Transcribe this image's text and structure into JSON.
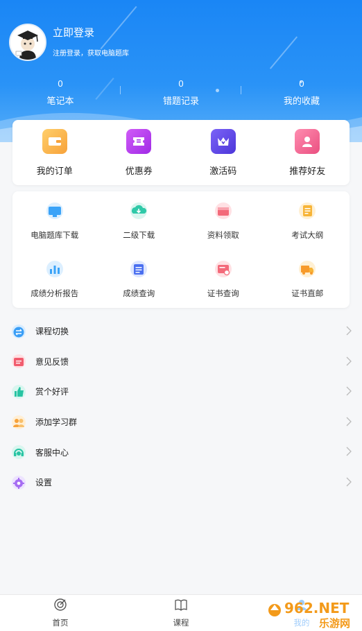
{
  "header": {
    "login_title": "立即登录",
    "login_subtitle": "注册登录，获取电脑题库",
    "stats": [
      {
        "value": "0",
        "label": "笔记本"
      },
      {
        "value": "0",
        "label": "错题记录"
      },
      {
        "value": "0",
        "label": "我的收藏"
      }
    ]
  },
  "quick_actions": [
    {
      "label": "我的订单",
      "icon": "wallet-icon",
      "color": "#f9b24a"
    },
    {
      "label": "优惠券",
      "icon": "coupon-icon",
      "color": "#b33ff0"
    },
    {
      "label": "激活码",
      "icon": "crown-icon",
      "color": "#6a4cf0"
    },
    {
      "label": "推荐好友",
      "icon": "user-icon",
      "color": "#f36f9a"
    }
  ],
  "services": [
    {
      "label": "电脑题库下载",
      "icon": "monitor-icon"
    },
    {
      "label": "二级下载",
      "icon": "cloud-download-icon"
    },
    {
      "label": "资料领取",
      "icon": "gift-icon"
    },
    {
      "label": "考试大纲",
      "icon": "document-icon"
    },
    {
      "label": "成绩分析报告",
      "icon": "bar-chart-icon"
    },
    {
      "label": "成绩查询",
      "icon": "search-list-icon"
    },
    {
      "label": "证书查询",
      "icon": "certificate-icon"
    },
    {
      "label": "证书直邮",
      "icon": "truck-icon"
    }
  ],
  "menu": [
    {
      "label": "课程切换",
      "icon": "switch-icon"
    },
    {
      "label": "意见反馈",
      "icon": "feedback-icon"
    },
    {
      "label": "赏个好评",
      "icon": "thumbs-up-icon"
    },
    {
      "label": "添加学习群",
      "icon": "group-icon"
    },
    {
      "label": "客服中心",
      "icon": "headset-icon"
    },
    {
      "label": "设置",
      "icon": "gear-icon"
    }
  ],
  "tabbar": [
    {
      "label": "首页",
      "icon": "target-icon"
    },
    {
      "label": "课程",
      "icon": "book-icon"
    },
    {
      "label": "我的",
      "icon": "profile-icon"
    }
  ],
  "watermark": {
    "brand": "962.NET",
    "site": "乐游网"
  }
}
